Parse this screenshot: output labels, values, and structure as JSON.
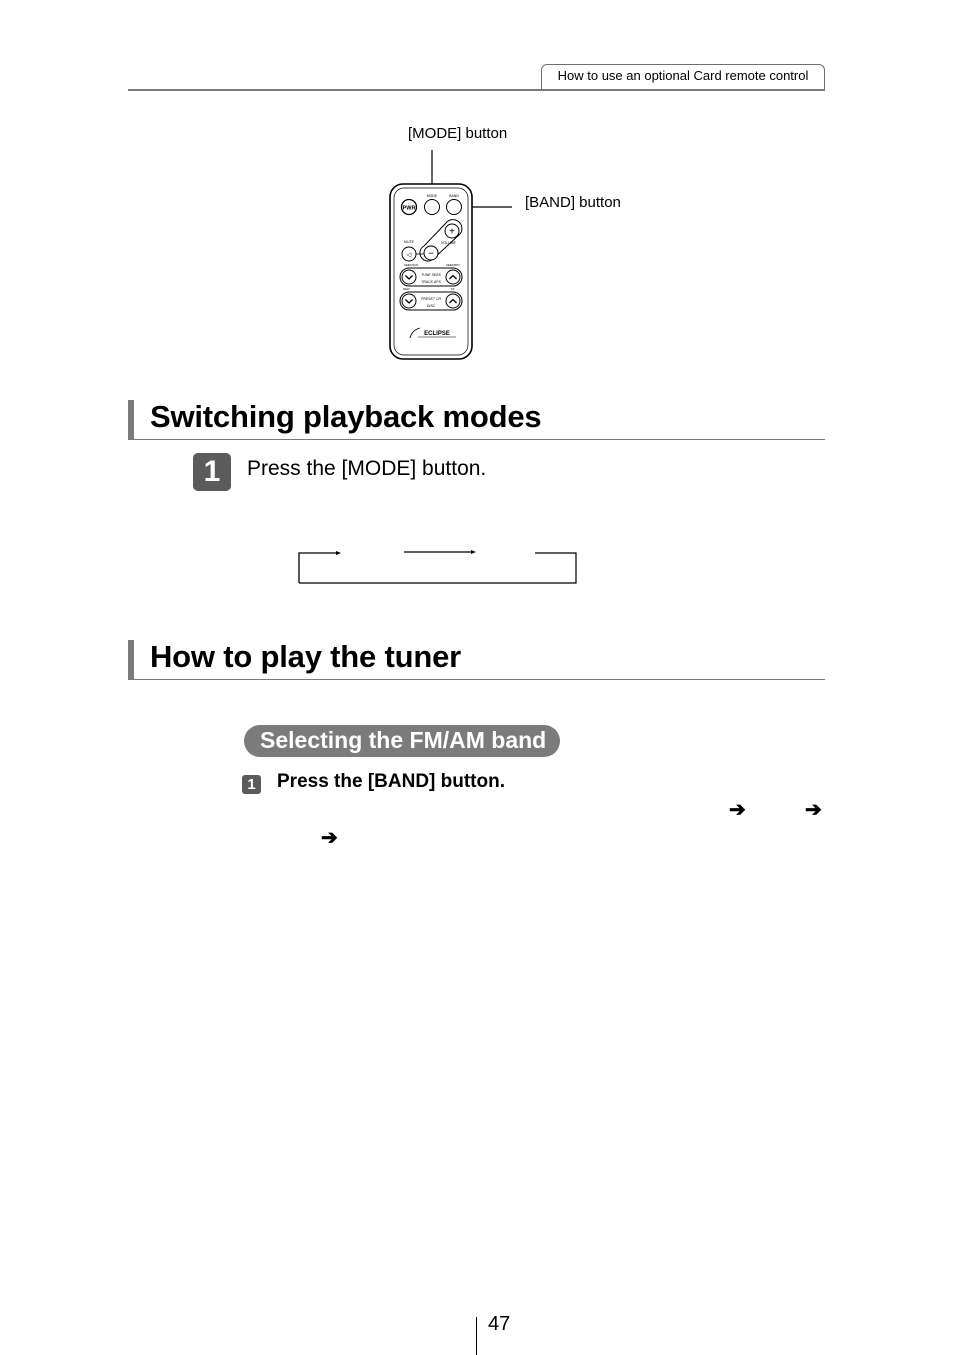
{
  "header": {
    "tab_label": "How to use an optional Card remote control"
  },
  "remote_figure": {
    "callouts": {
      "mode": "[MODE] button",
      "band": "[BAND] button"
    },
    "button_labels": {
      "pwr": "PWR",
      "mode": "MODE",
      "band": "BAND",
      "mute": "MUTE",
      "volume": "VOLUME",
      "tune_seek": "TUNE SEEK",
      "track_aps": "TRACK APS",
      "preset_ch": "PRESET CH",
      "disc": "DISC",
      "brand": "ECLIPSE"
    }
  },
  "sections": [
    {
      "title": "Switching playback modes",
      "steps": [
        {
          "number": "1",
          "text": "Press the [MODE] button."
        }
      ]
    },
    {
      "title": "How to play the tuner",
      "subheading": "Selecting the FM/AM band",
      "steps": [
        {
          "number": "1",
          "text": "Press the [BAND] button."
        }
      ],
      "arrows": [
        "➔",
        "➔",
        "➔"
      ]
    }
  ],
  "footer": {
    "page_number": "47"
  }
}
